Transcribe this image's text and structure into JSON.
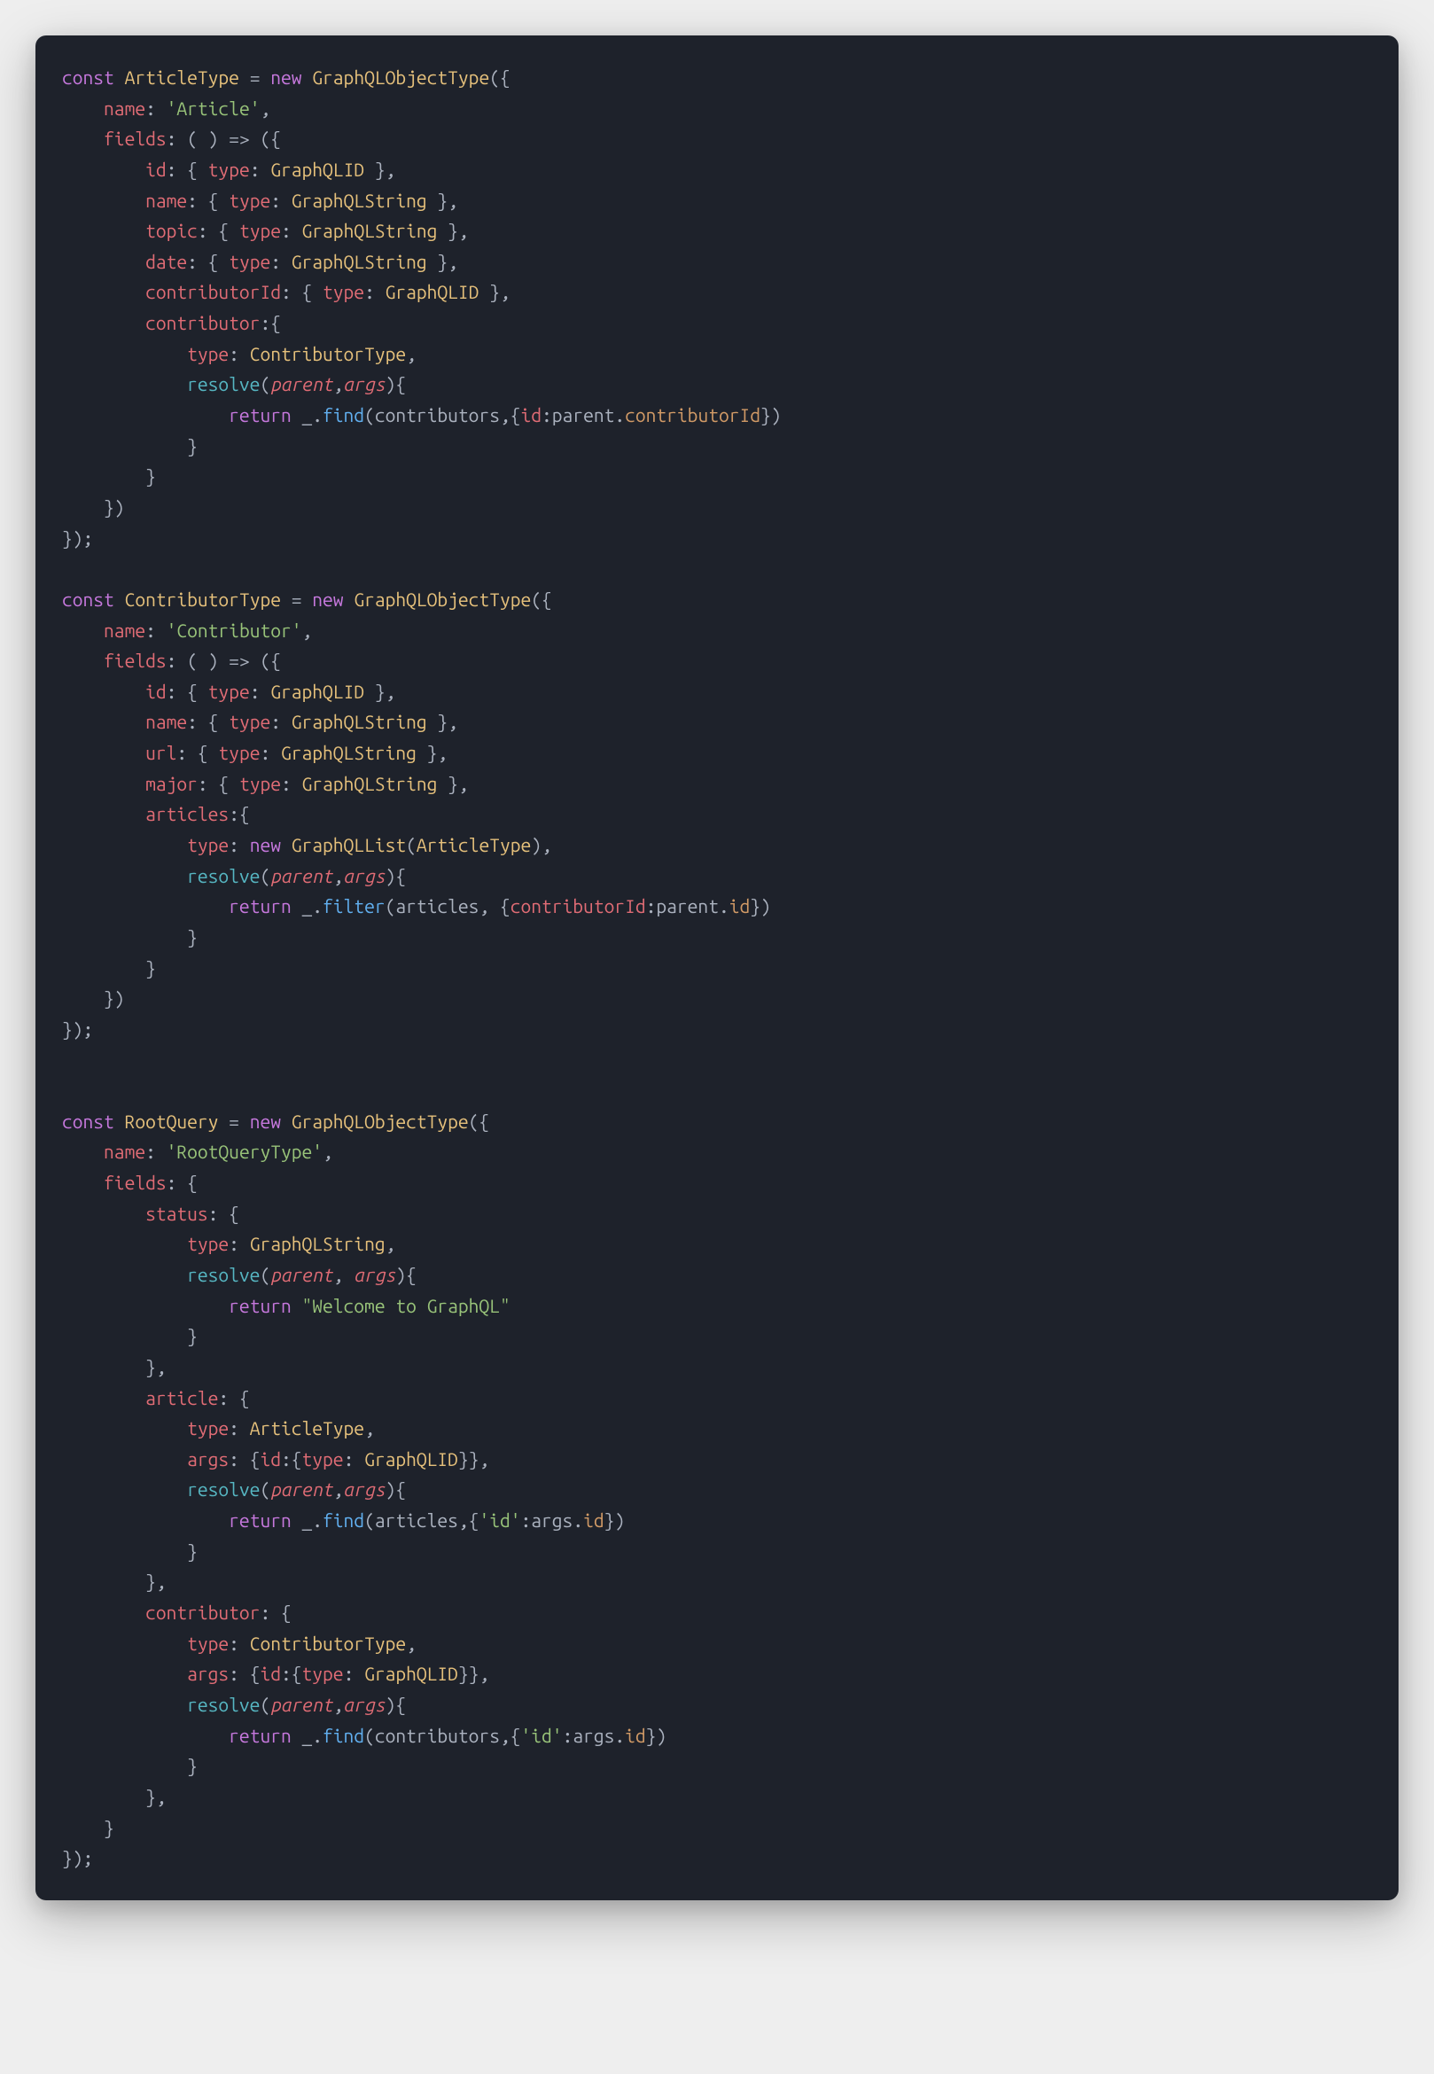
{
  "code": {
    "block1": {
      "decl": "const",
      "name": "ArticleType",
      "eq": " = ",
      "new": "new",
      "ctor": "GraphQLObjectType",
      "open": "({",
      "nameKey": "name",
      "nameVal": "'Article'",
      "fieldsKey": "fields",
      "fieldsOpen": ": ( ) => ({",
      "fields": {
        "id": {
          "key": "id",
          "open": ": { ",
          "typeKey": "type",
          "typeVal": "GraphQLID",
          "close": " },"
        },
        "name": {
          "key": "name",
          "open": ": { ",
          "typeKey": "type",
          "typeVal": "GraphQLString",
          "close": " },"
        },
        "topic": {
          "key": "topic",
          "open": ": { ",
          "typeKey": "type",
          "typeVal": "GraphQLString",
          "close": " },"
        },
        "date": {
          "key": "date",
          "open": ": { ",
          "typeKey": "type",
          "typeVal": "GraphQLString",
          "close": " },"
        },
        "cid": {
          "key": "contributorId",
          "open": ": { ",
          "typeKey": "type",
          "typeVal": "GraphQLID",
          "close": " },"
        },
        "contrib": {
          "key": "contributor",
          "open": ":{",
          "typeKey": "type",
          "typeVal": "ContributorType",
          "comma": ",",
          "resolve": "resolve",
          "rOpen": "(",
          "p": "parent",
          "c": ",",
          "a": "args",
          "rClose": "){",
          "ret": "return",
          "u": "_",
          "dot": ".",
          "find": "find",
          "fOpen": "(",
          "arg1": "contributors",
          "c2": ",{",
          "idKey": "id",
          "colon": ":",
          "parent": "parent",
          "dot2": ".",
          "cid": "contributorId",
          "fClose": "})",
          "brace1": "}",
          "brace2": "}"
        }
      },
      "closeFields": "})",
      "closeAll": "});"
    },
    "block2": {
      "decl": "const",
      "name": "ContributorType",
      "eq": " = ",
      "new": "new",
      "ctor": "GraphQLObjectType",
      "open": "({",
      "nameKey": "name",
      "nameVal": "'Contributor'",
      "fieldsKey": "fields",
      "fieldsOpen": ": ( ) => ({",
      "fields": {
        "id": {
          "key": "id",
          "open": ": { ",
          "typeKey": "type",
          "typeVal": "GraphQLID",
          "close": " },"
        },
        "name": {
          "key": "name",
          "open": ": { ",
          "typeKey": "type",
          "typeVal": "GraphQLString",
          "close": " },"
        },
        "url": {
          "key": "url",
          "open": ": { ",
          "typeKey": "type",
          "typeVal": "GraphQLString",
          "close": " },"
        },
        "major": {
          "key": "major",
          "open": ": { ",
          "typeKey": "type",
          "typeVal": "GraphQLString",
          "close": " },"
        },
        "articles": {
          "key": "articles",
          "open": ":{",
          "typeKey": "type",
          "new": "new",
          "list": "GraphQLList",
          "lOpen": "(",
          "arg": "ArticleType",
          "lClose": "),",
          "resolve": "resolve",
          "rOpen": "(",
          "p": "parent",
          "c": ",",
          "a": "args",
          "rClose": "){",
          "ret": "return",
          "u": "_",
          "dot": ".",
          "filter": "filter",
          "fOpen": "(",
          "arg1": "articles",
          "c2": ", {",
          "cidKey": "contributorId",
          "colon": ":",
          "parent": "parent",
          "dot2": ".",
          "id": "id",
          "fClose": "})",
          "brace1": "}",
          "brace2": "}"
        }
      },
      "closeFields": "})",
      "closeAll": "});"
    },
    "block3": {
      "decl": "const",
      "name": "RootQuery",
      "eq": " = ",
      "new": "new",
      "ctor": "GraphQLObjectType",
      "open": "({",
      "nameKey": "name",
      "nameVal": "'RootQueryType'",
      "fieldsKey": "fields",
      "fieldsOpen": ": {",
      "status": {
        "key": "status",
        "open": ": {",
        "typeKey": "type",
        "typeVal": "GraphQLString",
        "comma": ",",
        "resolve": "resolve",
        "rOpen": "(",
        "p": "parent",
        "c": ", ",
        "a": "args",
        "rClose": "){",
        "ret": "return",
        "str": "\"Welcome to GraphQL\"",
        "brace": "}",
        "close": "},"
      },
      "article": {
        "key": "article",
        "open": ": {",
        "typeKey": "type",
        "typeVal": "ArticleType",
        "comma": ",",
        "argsKey": "args",
        "argsOpen": ": {",
        "idKey": "id",
        "idOpen": ":{",
        "idTypeKey": "type",
        "idTypeVal": "GraphQLID",
        "argsClose": "}},",
        "resolve": "resolve",
        "rOpen": "(",
        "p": "parent",
        "c": ",",
        "a": "args",
        "rClose": "){",
        "ret": "return",
        "u": "_",
        "dot": ".",
        "find": "find",
        "fOpen": "(",
        "arg1": "articles",
        "c2": ",{",
        "idStr": "'id'",
        "colon": ":",
        "argsRef": "args",
        "dot2": ".",
        "id": "id",
        "fClose": "})",
        "brace": "}",
        "close": "},"
      },
      "contributor": {
        "key": "contributor",
        "open": ": {",
        "typeKey": "type",
        "typeVal": "ContributorType",
        "comma": ",",
        "argsKey": "args",
        "argsOpen": ": {",
        "idKey": "id",
        "idOpen": ":{",
        "idTypeKey": "type",
        "idTypeVal": "GraphQLID",
        "argsClose": "}},",
        "resolve": "resolve",
        "rOpen": "(",
        "p": "parent",
        "c": ",",
        "a": "args",
        "rClose": "){",
        "ret": "return",
        "u": "_",
        "dot": ".",
        "find": "find",
        "fOpen": "(",
        "arg1": "contributors",
        "c2": ",{",
        "idStr": "'id'",
        "colon": ":",
        "argsRef": "args",
        "dot2": ".",
        "id": "id",
        "fClose": "})",
        "brace": "}",
        "close": "},"
      },
      "closeFields": "}",
      "closeAll": "});"
    }
  }
}
